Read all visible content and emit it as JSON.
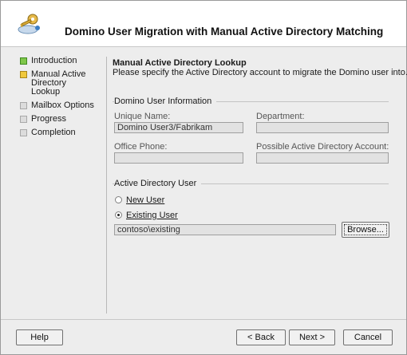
{
  "header": {
    "title": "Domino User Migration with Manual Active Directory Matching",
    "icon": "key-with-user-icon"
  },
  "nav": {
    "items": [
      {
        "label": "Introduction",
        "state": "done"
      },
      {
        "label": "Manual Active Directory Lookup",
        "state": "current"
      },
      {
        "label": "Mailbox Options",
        "state": "pending"
      },
      {
        "label": "Progress",
        "state": "pending"
      },
      {
        "label": "Completion",
        "state": "pending"
      }
    ],
    "colors": {
      "done": "#7fc74a",
      "current": "#f0c83c",
      "pending": "#dcdcdc"
    }
  },
  "page": {
    "title": "Manual Active Directory Lookup",
    "subtitle": "Please specify the Active Directory account to migrate the Domino user into."
  },
  "domino_info": {
    "group_label": "Domino User Information",
    "unique_name_label": "Unique Name:",
    "unique_name_value": "Domino User3/Fabrikam",
    "department_label": "Department:",
    "department_value": "",
    "office_phone_label": "Office Phone:",
    "office_phone_value": "",
    "possible_ad_label": "Possible Active Directory Account:",
    "possible_ad_value": ""
  },
  "ad_user": {
    "group_label": "Active Directory User",
    "new_user_label": "New User",
    "existing_user_label": "Existing User",
    "selected": "existing",
    "account_value": "contoso\\existing",
    "browse_label": "Browse..."
  },
  "footer": {
    "help_label": "Help",
    "back_label": "< Back",
    "next_label": "Next >",
    "cancel_label": "Cancel"
  }
}
